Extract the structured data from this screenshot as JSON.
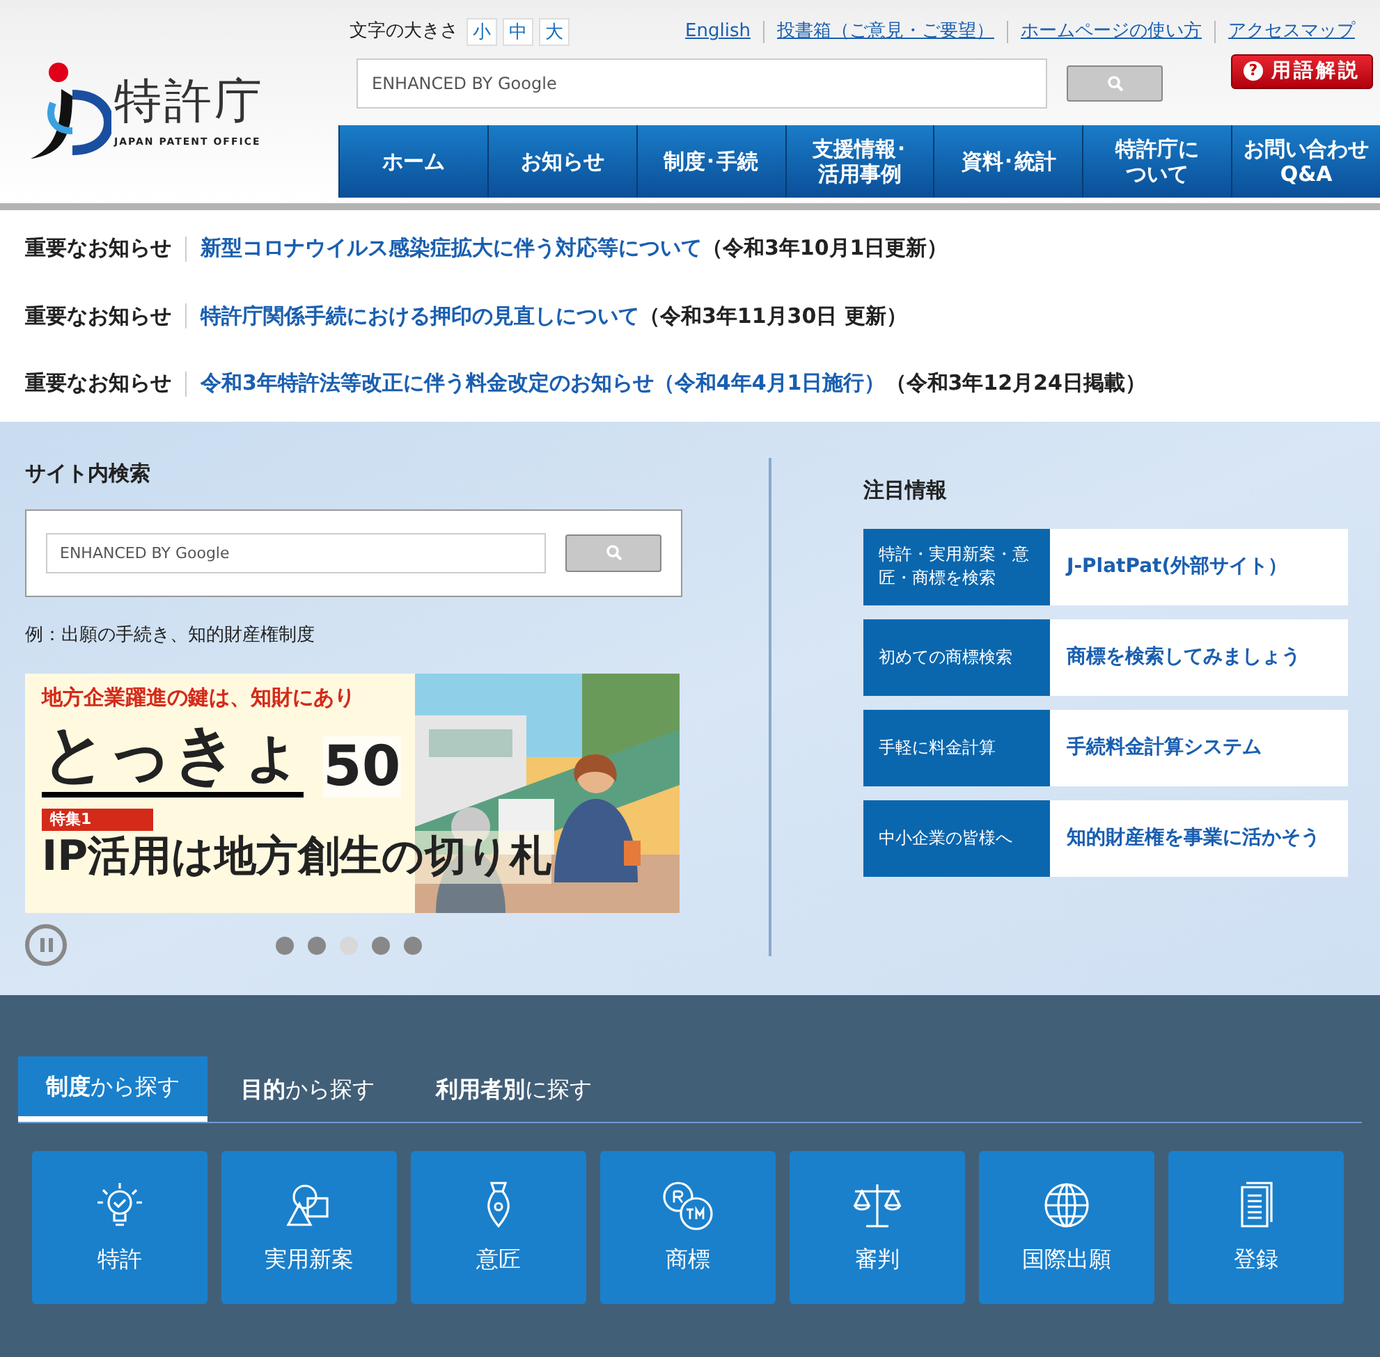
{
  "logo": {
    "name": "特許庁",
    "subtitle": "JAPAN PATENT OFFICE"
  },
  "font_size": {
    "label": "文字の大きさ",
    "options": [
      "小",
      "中",
      "大"
    ]
  },
  "utility_links": [
    "English",
    "投書箱（ご意見・ご要望）",
    "ホームページの使い方",
    "アクセスマップ"
  ],
  "header_search": {
    "placeholder": "ENHANCED BY Google"
  },
  "glossary_button": {
    "icon": "?",
    "label": "用語解説"
  },
  "nav": [
    "ホーム",
    "お知らせ",
    "制度･手続",
    "支援情報･活用事例",
    "資料･統計",
    "特許庁について",
    "お問い合わせQ&A"
  ],
  "notices": [
    {
      "tag": "重要なお知らせ",
      "link": "新型コロナウイルス感染症拡大に伴う対応等について",
      "note": "（令和3年10月1日更新）"
    },
    {
      "tag": "重要なお知らせ",
      "link": "特許庁関係手続における押印の見直しについて",
      "note": "（令和3年11月30日 更新）"
    },
    {
      "tag": "重要なお知らせ",
      "link": "令和3年特許法等改正に伴う料金改定のお知らせ（令和4年4月1日施行）",
      "note": "（令和3年12月24日掲載）"
    }
  ],
  "site_search": {
    "title": "サイト内検索",
    "placeholder": "ENHANCED BY Google",
    "example": "例：出願の手続き、知的財産権制度"
  },
  "banner": {
    "tagline": "地方企業躍進の鍵は、知財にあり",
    "title": "とっきょ",
    "number": "50",
    "feature": "特集1",
    "headline": "IP活用は地方創生の切り札"
  },
  "carousel_dots": [
    {
      "selected": false
    },
    {
      "selected": false
    },
    {
      "selected": true
    },
    {
      "selected": false
    },
    {
      "selected": false
    }
  ],
  "featured": {
    "title": "注目情報",
    "items": [
      {
        "label": "特許・実用新案・意匠・商標を検索",
        "link": "J-PlatPat(外部サイト）"
      },
      {
        "label": "初めての商標検索",
        "link": "商標を検索してみましょう"
      },
      {
        "label": "手軽に料金計算",
        "link": "手続料金計算システム"
      },
      {
        "label": "中小企業の皆様へ",
        "link": "知的財産権を事業に活かそう"
      }
    ]
  },
  "browse_tabs": [
    {
      "label": "**制度**から探す",
      "selected": true
    },
    {
      "label": "**目的**から探す",
      "selected": false
    },
    {
      "label": "**利用者別**に探す",
      "selected": false
    }
  ],
  "categories": [
    {
      "kind": "bulb",
      "label": "特許"
    },
    {
      "kind": "shapes",
      "label": "実用新案"
    },
    {
      "kind": "pen",
      "label": "意匠"
    },
    {
      "kind": "trademark",
      "label": "商標"
    },
    {
      "kind": "scales",
      "label": "審判"
    },
    {
      "kind": "globe",
      "label": "国際出願"
    },
    {
      "kind": "document",
      "label": "登録"
    }
  ]
}
